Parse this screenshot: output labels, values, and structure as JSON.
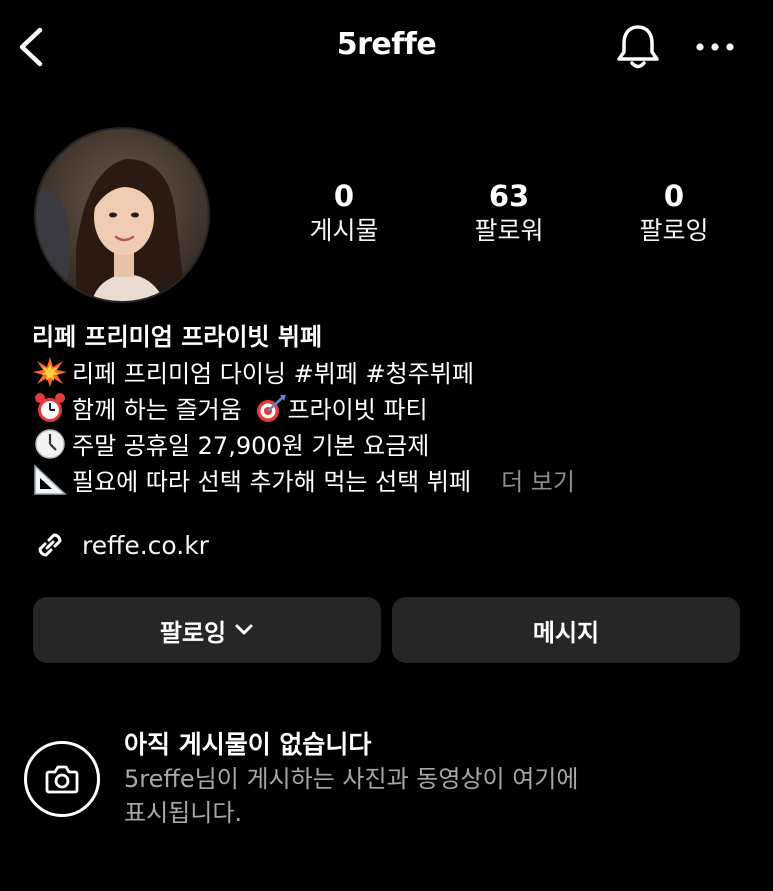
{
  "header": {
    "username": "5reffe",
    "back_icon": "chevron-left-icon",
    "notification_icon": "bell-icon",
    "more_icon": "more-horizontal-icon"
  },
  "profile": {
    "avatar_alt": "profile photo",
    "stats": [
      {
        "value": "0",
        "label": "게시물"
      },
      {
        "value": "63",
        "label": "팔로워"
      },
      {
        "value": "0",
        "label": "팔로잉"
      }
    ]
  },
  "bio": {
    "name": "리페 프리미엄 프라이빗 뷔페",
    "line1": "리페 프리미엄 다이닝 #뷔페 #청주뷔페",
    "line2a": "함께 하는 즐거움",
    "line2b": "프라이빗 파티",
    "line3": "주말 공휴일 27,900원 기본 요금제",
    "line4": "필요에 따라 선택 추가해 먹는 선택 뷔페",
    "more_label": "더 보기",
    "icons": [
      "collision-icon",
      "alarm-clock-icon",
      "direct-hit-icon",
      "clock-icon",
      "triangular-ruler-icon"
    ]
  },
  "website": {
    "icon": "link-icon",
    "text": "reffe.co.kr"
  },
  "actions": {
    "following_label": "팔로잉",
    "message_label": "메시지"
  },
  "empty_state": {
    "icon": "camera-icon",
    "title": "아직 게시물이 없습니다",
    "description": "5reffe님이 게시하는 사진과 동영상이 여기에 표시됩니다."
  },
  "colors": {
    "background": "#000000",
    "button": "#262626",
    "muted": "#8e8e8e"
  }
}
